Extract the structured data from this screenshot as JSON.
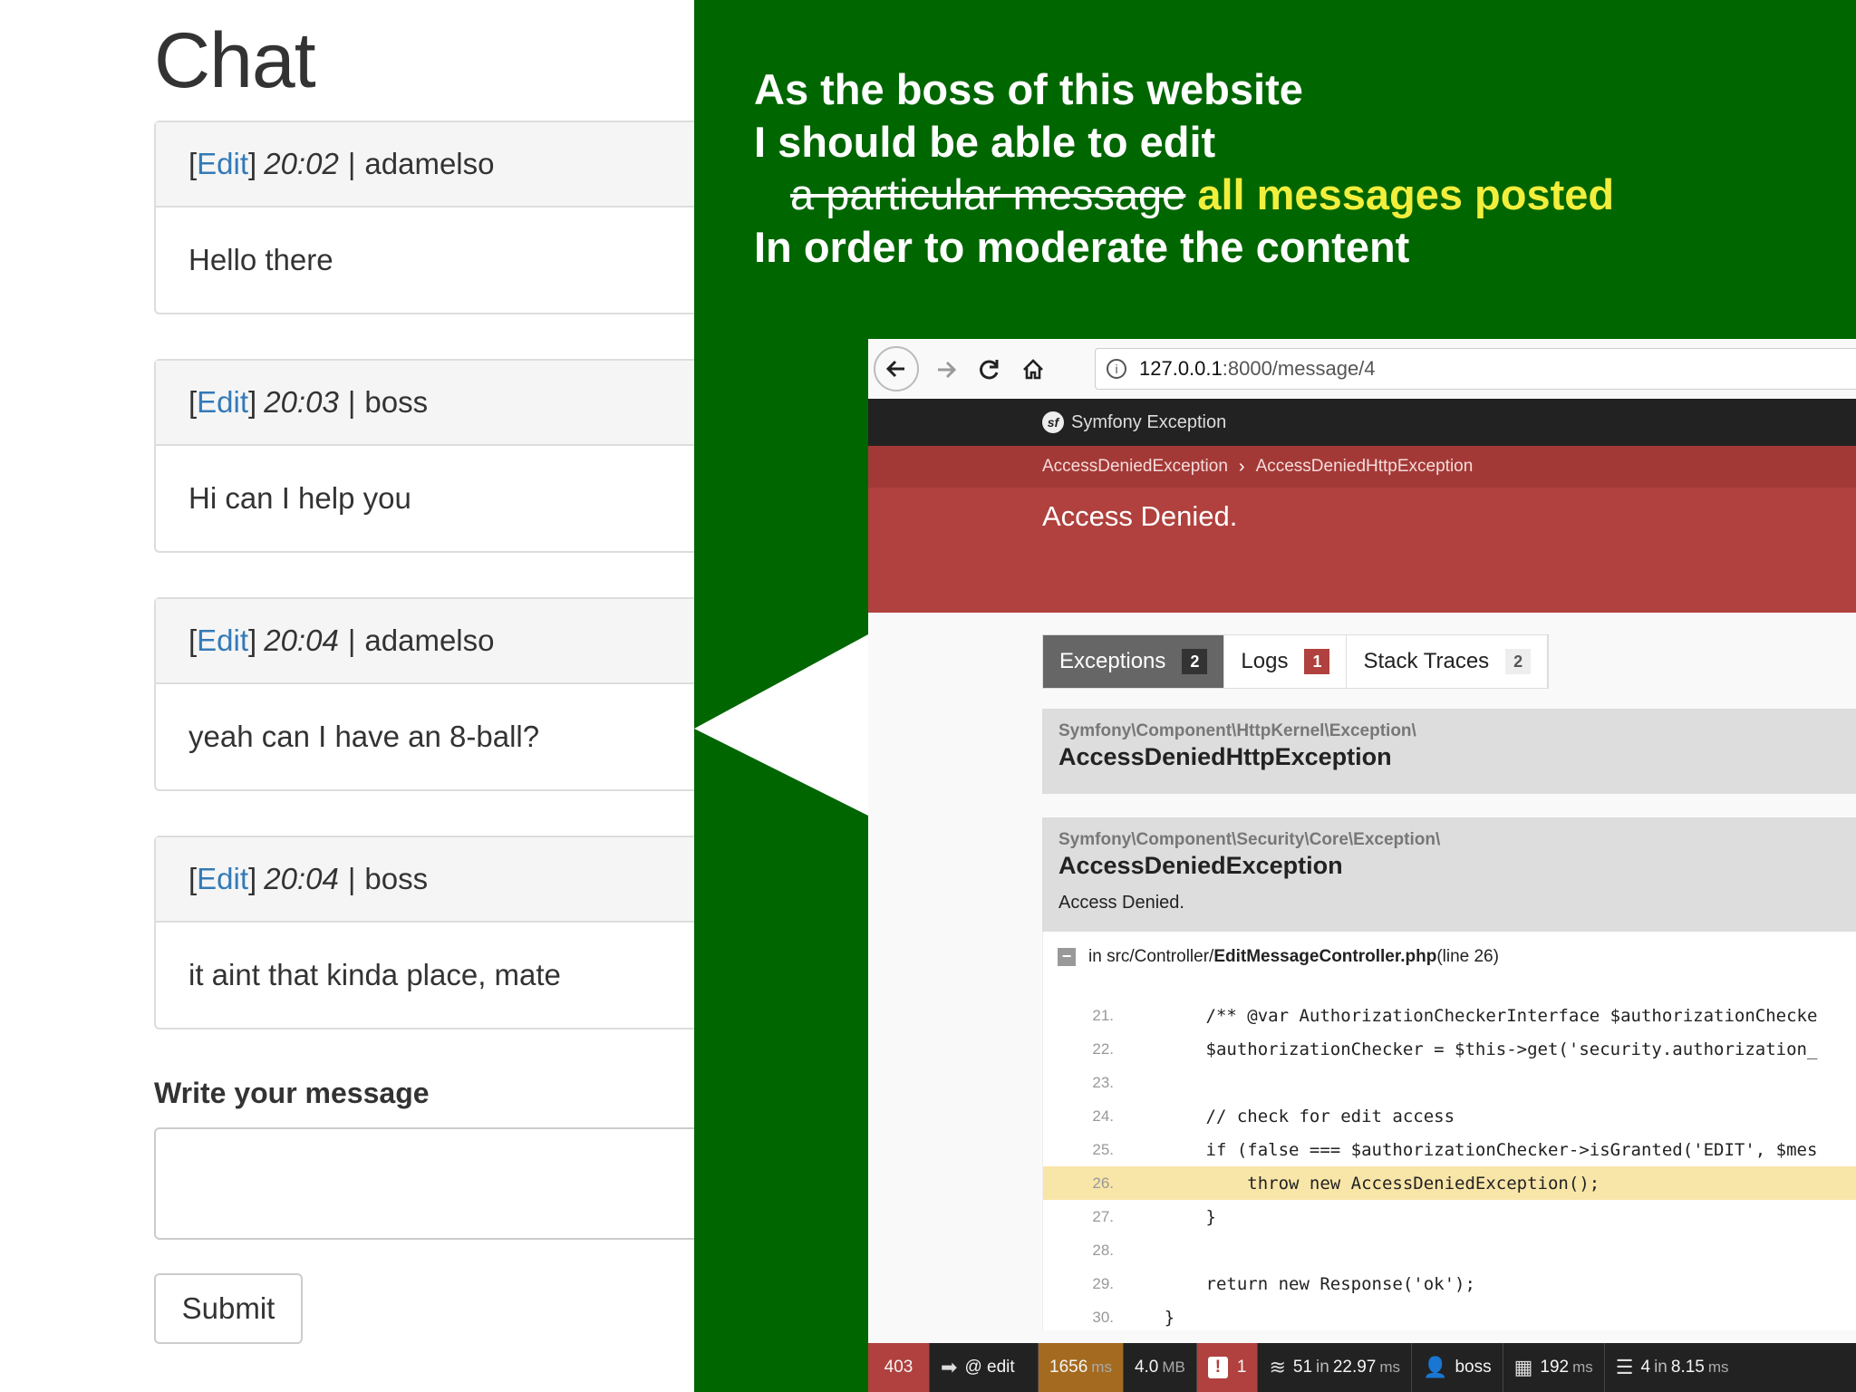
{
  "chat": {
    "title": "Chat",
    "edit_label": "Edit",
    "messages": [
      {
        "time": "20:02",
        "user": "adamelso",
        "text": "Hello there"
      },
      {
        "time": "20:03",
        "user": "boss",
        "text": "Hi can I help you"
      },
      {
        "time": "20:04",
        "user": "adamelso",
        "text": "yeah can I have an 8-ball?"
      },
      {
        "time": "20:04",
        "user": "boss",
        "text": "it aint that kinda place, mate"
      }
    ],
    "write_label": "Write your message",
    "message_value": "",
    "submit_label": "Submit"
  },
  "story": {
    "line1": "As the boss of this website",
    "line2": "I should be able to edit",
    "struck": "a particular message",
    "highlight": "all messages posted",
    "line4": "In order to moderate the content"
  },
  "browser": {
    "url_host": "127.0.0.1",
    "url_path": ":8000/message/4",
    "icons": [
      "back-arrow-icon",
      "forward-arrow-icon",
      "reload-icon",
      "home-icon",
      "info-icon"
    ]
  },
  "symfony": {
    "brand": "Symfony Exception",
    "breadcrumb": [
      "AccessDeniedException",
      "AccessDeniedHttpException"
    ],
    "title": "Access Denied.",
    "tabs": [
      {
        "label": "Exceptions",
        "count": "2"
      },
      {
        "label": "Logs",
        "count": "1"
      },
      {
        "label": "Stack Traces",
        "count": "2"
      }
    ],
    "exceptions": [
      {
        "namespace": "Symfony\\Component\\HttpKernel\\Exception\\",
        "name": "AccessDeniedHttpException",
        "message": ""
      },
      {
        "namespace": "Symfony\\Component\\Security\\Core\\Exception\\",
        "name": "AccessDeniedException",
        "message": "Access Denied."
      }
    ],
    "trace": {
      "prefix": "in src/Controller/",
      "file": "EditMessageController.php",
      "suffix": " (line 26)"
    },
    "code_lines": [
      {
        "n": "21.",
        "code": "        /** @var AuthorizationCheckerInterface $authorizationChecke"
      },
      {
        "n": "22.",
        "code": "        $authorizationChecker = $this->get('security.authorization_"
      },
      {
        "n": "23.",
        "code": ""
      },
      {
        "n": "24.",
        "code": "        // check for edit access"
      },
      {
        "n": "25.",
        "code": "        if (false === $authorizationChecker->isGranted('EDIT', $mes"
      },
      {
        "n": "26.",
        "code": "            throw new AccessDeniedException();"
      },
      {
        "n": "27.",
        "code": "        }"
      },
      {
        "n": "28.",
        "code": ""
      },
      {
        "n": "29.",
        "code": "        return new Response('ok');"
      },
      {
        "n": "30.",
        "code": "    }"
      }
    ],
    "highlighted_line": "26."
  },
  "debugbar": {
    "status": "403",
    "route": "@ edit",
    "time_value": "1656",
    "time_unit": "ms",
    "memory_value": "4.0",
    "memory_unit": "MB",
    "logs_count": "1",
    "cache_count": "51",
    "cache_in": "in",
    "cache_time": "22.97",
    "cache_unit": "ms",
    "user": "boss",
    "render_time": "192",
    "render_unit": "ms",
    "db_count": "4",
    "db_in": "in",
    "db_time": "8.15",
    "db_unit": "ms"
  },
  "colors": {
    "slide_green": "#006600",
    "highlight_yellow": "#f2ee3c",
    "symfony_red": "#b0413e",
    "link_blue": "#337ab7"
  }
}
